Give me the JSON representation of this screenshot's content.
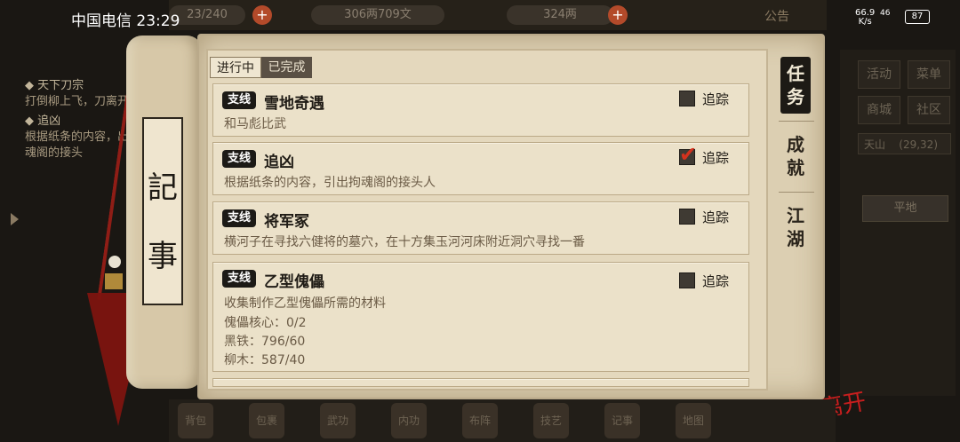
{
  "status_bar": {
    "carrier_time": "中国电信 23:29",
    "net_speed": "66.9",
    "net_unit": "K/s",
    "signal": "46",
    "battery": "87"
  },
  "top_bar": {
    "stamina": "23/240",
    "silver": "306两709文",
    "gold": "324两",
    "notice": "公告"
  },
  "left_panel": {
    "q1_title": "◆ 天下刀宗",
    "q1_desc": "打倒柳上飞，刀离开",
    "q2_title": "◆ 追凶",
    "q2_desc": "根据纸条的内容，出拘魂阁的接头"
  },
  "scroll": {
    "char1": "記",
    "char2": "事"
  },
  "tabs": {
    "in_progress": "进行中",
    "completed": "已完成"
  },
  "side_tabs": {
    "task": [
      "任",
      "务"
    ],
    "achievement": [
      "成",
      "就"
    ],
    "jianghu": [
      "江",
      "湖"
    ]
  },
  "quests": [
    {
      "tag": "支线",
      "title": "雪地奇遇",
      "desc": "和马彪比武",
      "track_label": "追踪",
      "tracked": false,
      "lines": []
    },
    {
      "tag": "支线",
      "title": "追凶",
      "desc": "根据纸条的内容，引出拘魂阁的接头人",
      "track_label": "追踪",
      "tracked": true,
      "lines": []
    },
    {
      "tag": "支线",
      "title": "将军冢",
      "desc": "横河子在寻找六健将的墓穴，在十方集玉河河床附近洞穴寻找一番",
      "track_label": "追踪",
      "tracked": false,
      "lines": []
    },
    {
      "tag": "支线",
      "title": "乙型傀儡",
      "desc": "收集制作乙型傀儡所需的材料",
      "track_label": "追踪",
      "tracked": false,
      "lines": [
        "傀儡核心：0/2",
        "黑铁：796/60",
        "柳木：587/40"
      ]
    }
  ],
  "right_panel": {
    "activity": "活动",
    "menu": "菜单",
    "shop": "商城",
    "community": "社区",
    "location": "天山",
    "coords": "(29,32)",
    "terrain": "平地"
  },
  "leave_label": "离开",
  "bottom_bar": [
    "背包",
    "包裹",
    "武功",
    "内功",
    "布阵",
    "技艺",
    "记事",
    "地图"
  ]
}
